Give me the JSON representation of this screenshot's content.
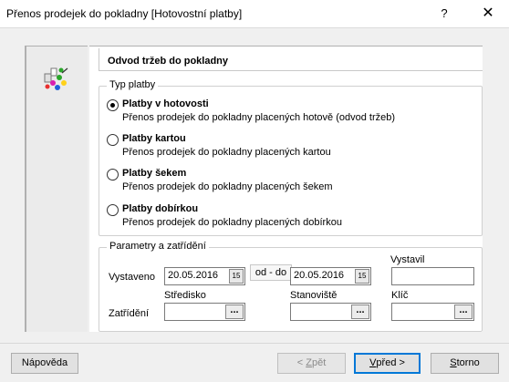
{
  "window": {
    "title": "Přenos prodejek do pokladny [Hotovostní platby]",
    "help_glyph": "?",
    "close_glyph": "✕"
  },
  "panel": {
    "header": "Odvod tržeb do pokladny"
  },
  "payment_type": {
    "legend": "Typ platby",
    "options": [
      {
        "title": "Platby v hotovosti",
        "desc": "Přenos prodejek do pokladny placených hotově (odvod tržeb)",
        "checked": true
      },
      {
        "title": "Platby kartou",
        "desc": "Přenos prodejek do pokladny placených kartou",
        "checked": false
      },
      {
        "title": "Platby šekem",
        "desc": "Přenos prodejek do pokladny placených šekem",
        "checked": false
      },
      {
        "title": "Platby dobírkou",
        "desc": "Přenos prodejek do pokladny placených  dobírkou",
        "checked": false
      }
    ]
  },
  "params": {
    "legend": "Parametry a zatřídění",
    "issued_label": "Vystaveno",
    "date_from": "20.05.2016",
    "date_to": "20.05.2016",
    "cal_glyph": "15",
    "range_label": "od - do",
    "issuer_label": "Vystavil",
    "issuer_value": "",
    "classify_label": "Zatřídění",
    "center_label": "Středisko",
    "station_label": "Stanoviště",
    "key_label": "Klíč",
    "center_value": "",
    "station_value": "",
    "key_value": "",
    "lookup_glyph": "..."
  },
  "buttons": {
    "help": "Nápověda",
    "back_prefix": "< ",
    "back_key": "Z",
    "back_rest": "pět",
    "next_key": "V",
    "next_rest": "před >",
    "cancel_key": "S",
    "cancel_rest": "torno"
  },
  "colors": {
    "accent": "#0078d7",
    "background": "#f0f0f0"
  }
}
